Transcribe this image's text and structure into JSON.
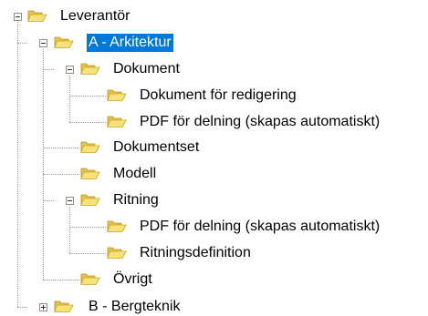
{
  "tree": {
    "root": {
      "label": "Leverantör",
      "children": [
        {
          "label": "A - Arkitektur",
          "selected": true,
          "children": [
            {
              "label": "Dokument",
              "children": [
                {
                  "label": "Dokument för redigering"
                },
                {
                  "label": "PDF för delning (skapas automatiskt)"
                }
              ]
            },
            {
              "label": "Dokumentset"
            },
            {
              "label": "Modell"
            },
            {
              "label": "Ritning",
              "children": [
                {
                  "label": "PDF för delning (skapas automatiskt)"
                },
                {
                  "label": "Ritningsdefinition"
                }
              ]
            },
            {
              "label": "Övrigt"
            }
          ]
        },
        {
          "label": "B - Bergteknik",
          "collapsed": true
        }
      ]
    }
  },
  "colors": {
    "selection": "#0078d7",
    "folder_fill": "#f2dc72",
    "folder_outline": "#c9a521"
  },
  "icons": {
    "expander_expanded": "minus-box-icon",
    "expander_collapsed": "plus-box-icon",
    "folder": "open-folder-icon"
  }
}
